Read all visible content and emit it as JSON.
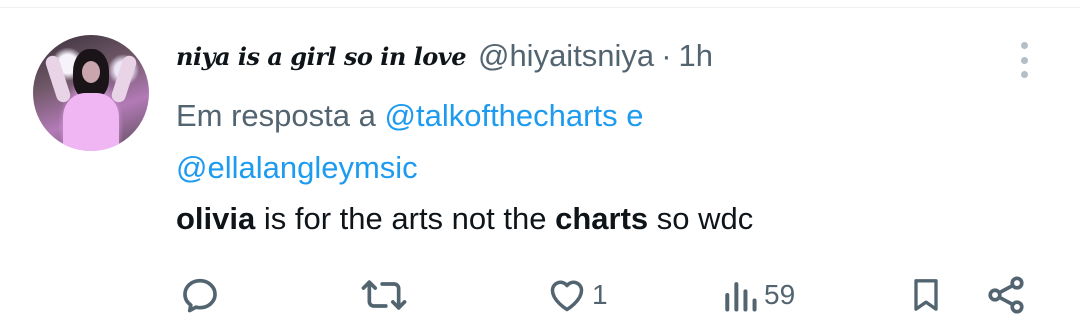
{
  "tweet": {
    "display_name": "niya is a girl so in love",
    "handle": "@hiyaitsniya",
    "separator": "·",
    "time": "1h",
    "reply_prefix": "Em resposta a",
    "reply_mention_1": "@talkofthecharts",
    "reply_connector": "e",
    "reply_mention_2": "@ellalangleymsic",
    "text": {
      "part1": "olivia",
      "part2": " is for the arts not the ",
      "part3": "charts",
      "part4": " so wdc"
    }
  },
  "actions": {
    "reply_icon": "reply-icon",
    "retweet_icon": "retweet-icon",
    "like_icon": "heart-icon",
    "like_count": "1",
    "views_icon": "views-icon",
    "views_count": "59",
    "bookmark_icon": "bookmark-icon",
    "share_icon": "share-icon"
  },
  "colors": {
    "link": "#1d9bf0",
    "secondary_text": "#536471",
    "primary_text": "#0f1419"
  }
}
